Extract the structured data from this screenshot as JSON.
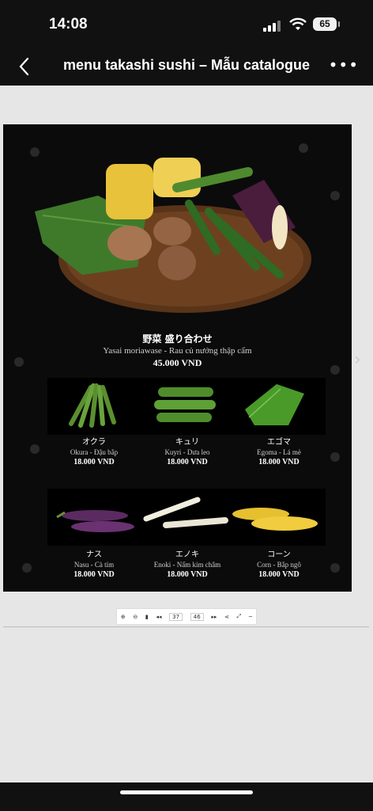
{
  "status": {
    "time": "14:08",
    "battery": "65"
  },
  "nav": {
    "title": "menu takashi sushi – Mẫu catalogue"
  },
  "hero": {
    "name_jp": "野菜 盛り合わせ",
    "subtitle": "Yasai moriawase - Rau củ nướng thập cẩm",
    "price": "45.000 VND"
  },
  "row1": [
    {
      "name": "オクラ",
      "desc": "Okura - Đậu bắp",
      "price": "18.000 VND"
    },
    {
      "name": "キュリ",
      "desc": "Kuyri - Dưa leo",
      "price": "18.000 VND"
    },
    {
      "name": "エゴマ",
      "desc": "Egoma - Lá mè",
      "price": "18.000 VND"
    }
  ],
  "row2": [
    {
      "name": "ナス",
      "desc": "Nasu - Cà tím",
      "price": "18.000 VND"
    },
    {
      "name": "エノキ",
      "desc": "Enoki - Nấm kim châm",
      "price": "18.000 VND"
    },
    {
      "name": "コーン",
      "desc": "Corn - Bắp ngô",
      "price": "18.000 VND"
    }
  ],
  "toolbar": {
    "page_current": "37",
    "page_total": "46"
  }
}
